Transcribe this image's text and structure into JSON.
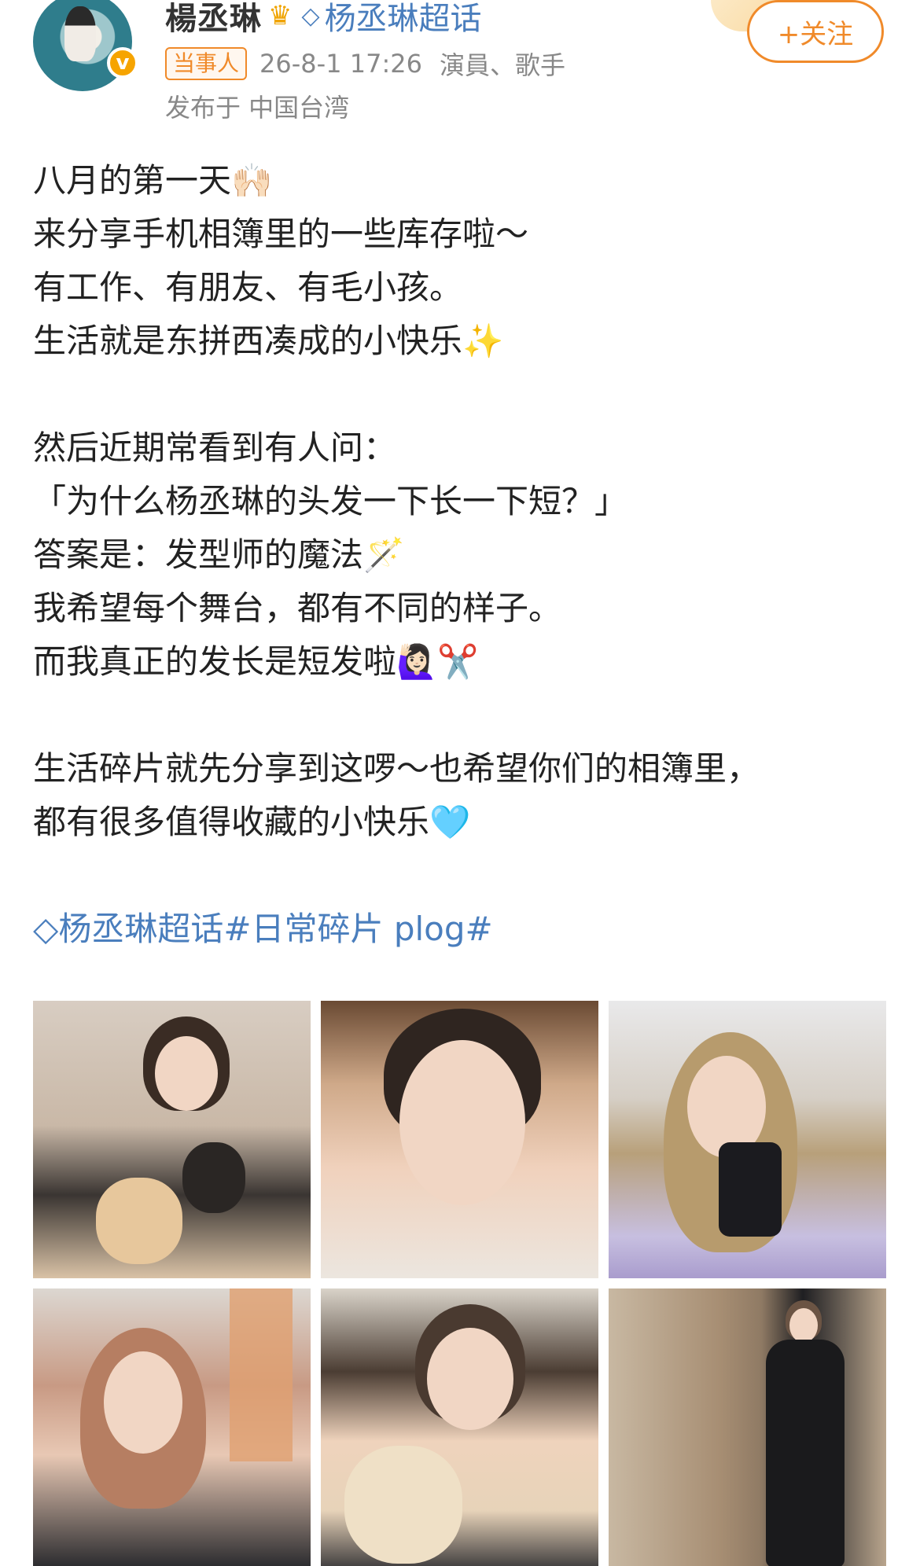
{
  "header": {
    "username": "楊丞琳",
    "crown_icon": "crown-icon",
    "supertopic_icon": "diamond-icon",
    "supertopic_label": "杨丞琳超话",
    "tag": "当事人",
    "time": "26-8-1 17:26",
    "role": "演員、歌手",
    "location": "发布于 中国台湾",
    "follow_label": "+关注",
    "verify_badge": "v"
  },
  "post": {
    "lines": [
      "八月的第一天🙌🏻",
      "来分享手机相簿里的一些库存啦～",
      "有工作、有朋友、有毛小孩。",
      "生活就是东拼西凑成的小快乐✨",
      "",
      "然后近期常看到有人问：",
      "「为什么杨丞琳的头发一下长一下短？」",
      "答案是：发型师的魔法🪄",
      "我希望每个舞台，都有不同的样子。",
      "而我真正的发长是短发啦🙋🏻‍♀️✂️",
      "",
      "生活碎片就先分享到这啰～也希望你们的相簿里，",
      "都有很多值得收藏的小快乐🩵"
    ],
    "topic_line": "杨丞琳超话#日常碎片 plog#"
  },
  "photos": [
    {
      "name": "photo-woman-with-dogs"
    },
    {
      "name": "photo-selfie-closeup"
    },
    {
      "name": "photo-mirror-selfie-phone"
    },
    {
      "name": "photo-car-portrait"
    },
    {
      "name": "photo-with-poodle"
    },
    {
      "name": "photo-full-length-mirror"
    }
  ],
  "colors": {
    "accent_orange": "#f08a2a",
    "link_blue": "#4a7ebd",
    "meta_gray": "#888888"
  }
}
